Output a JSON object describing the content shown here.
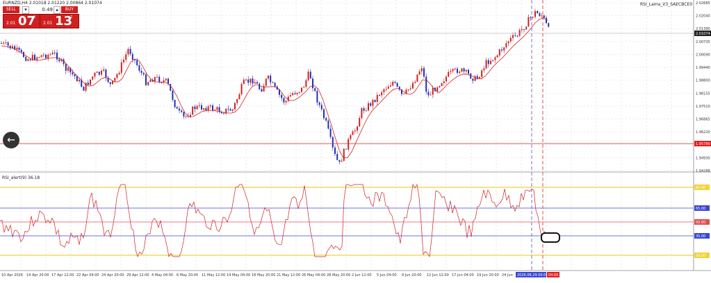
{
  "symbol_caption": "EURNZD,H4  2.01018 2.01220 2.00864 2.01074",
  "indicator_main_caption": "RSI_Lama_V3_SAECBCE0",
  "indicator_sub_caption": "RSI_alert(9) 36.18",
  "trade_panel": {
    "sell_label": "SELL",
    "buy_label": "BUY",
    "lot": "0.49",
    "sell_prefix": "2.01",
    "sell_big": "07",
    "sell_sup": "4",
    "buy_prefix": "2.01",
    "buy_big": "13",
    "buy_sup": "2"
  },
  "price_axis": {
    "ticks": [
      "2.02685",
      "2.02040",
      "2.01390",
      "2.00735",
      "2.00090",
      "1.99440",
      "1.98800",
      "1.98155",
      "1.97510",
      "1.96865",
      "1.96220",
      "1.95575",
      "1.94930",
      "1.94288"
    ],
    "current_price": "2.01074",
    "alert_price": "1.95786"
  },
  "rsi_axis": {
    "levels": [
      "80.00",
      "65.00",
      "50.00",
      "35.00",
      "20.00"
    ]
  },
  "time_axis": {
    "labels": [
      "10 Apr 2026",
      "14 Apr 20:00",
      "17 Apr 12:00",
      "22 Apr 04:00",
      "24 Apr 20:00",
      "29 Apr 12:00",
      "4 May 04:00",
      "6 May 20:00",
      "11 May 12:00",
      "14 May 04:00",
      "18 May 20:00",
      "21 May 12:00",
      "26 May 04:00",
      "28 May 20:00",
      "2 Jun 12:00",
      "5 Jun 04:00",
      "9 Jun 20:00",
      "12 Jun 12:00",
      "17 Jun 04:00",
      "19 Jun 20:00",
      "24 Jun"
    ],
    "cursor_label": "2026.06.29 00:00",
    "cursor_label2": "04:00"
  },
  "colors": {
    "bull": "#d11f1f",
    "bear": "#1f2fb8",
    "ma": "#d11f1f",
    "alert_line": "#e02020",
    "level_yellow": "#f2d23a",
    "level_blue": "#3a47d4",
    "level_red": "#e05050"
  },
  "icons": {
    "back": "back-arrow-icon",
    "close_oval": "oval-marker"
  }
}
